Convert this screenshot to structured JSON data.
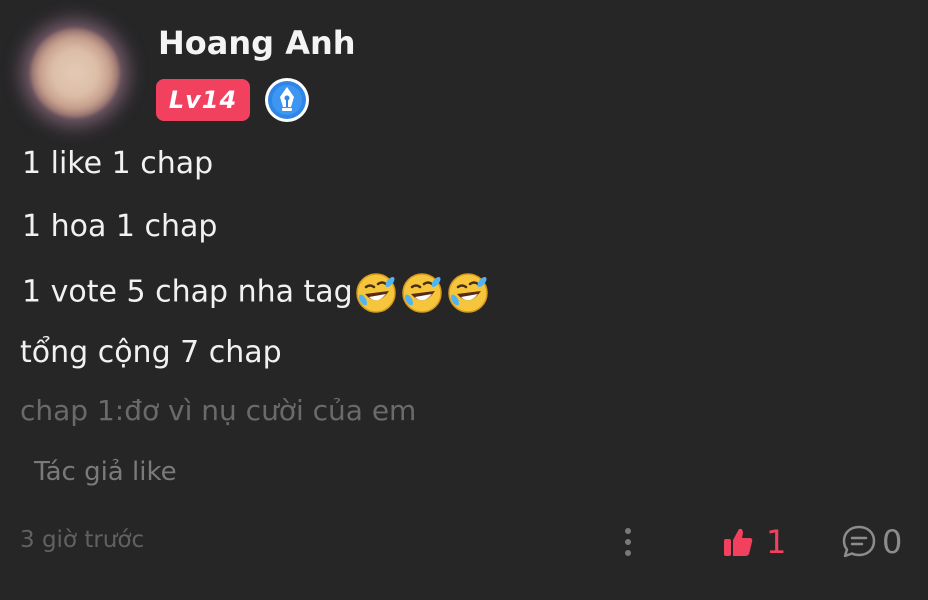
{
  "user": {
    "name": "Hoang Anh",
    "level": "Lv14",
    "badge_icon": "pen-nib-icon"
  },
  "comment": {
    "lines": [
      "1 like 1 chap",
      "1 hoa 1 chap",
      "1 vote 5 chap nha tag",
      "tổng cộng 7 chap"
    ],
    "emoji": "rolling-on-floor-laughing-icon",
    "emoji_count": 3,
    "preview": "chap 1:đơ vì nụ cười của em",
    "author_like": "Tác giả like",
    "time": "3 giờ trước"
  },
  "actions": {
    "like_count": "1",
    "comment_count": "0",
    "like_color": "#f2405f"
  },
  "colors": {
    "background": "#262627",
    "level_badge": "#f2405f",
    "pen_badge": "#2f86e6"
  }
}
